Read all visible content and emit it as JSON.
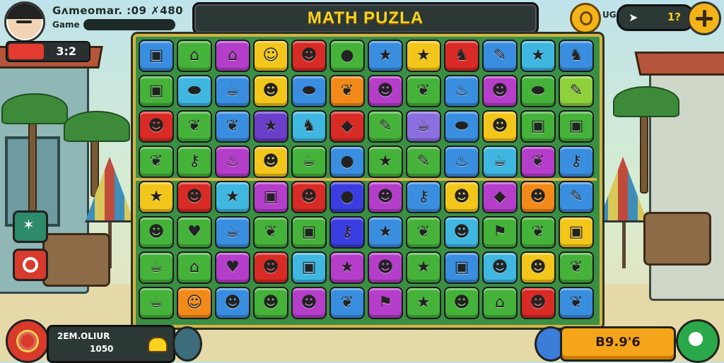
{
  "hud": {
    "player_name": "Gʌmeomar. :09  ✗480",
    "player_sub": "Game",
    "timer": "3:2",
    "timer_fraction": 0.45,
    "title": "MATH PUZLA",
    "coin_label": "UG",
    "count": "1?",
    "score_label": "2EM.OLIUR",
    "score_value": "1050",
    "points": "B9.9'6"
  },
  "colors": {
    "accent_gold": "#f7d21e",
    "board_border": "#d3b446",
    "hud_dark": "#2c3836"
  },
  "board": {
    "rows": 8,
    "cols": 12,
    "tiles": [
      [
        {
          "c": "#3a8ee0",
          "i": "cube-icon"
        },
        {
          "c": "#45b23a",
          "i": "house-icon"
        },
        {
          "c": "#b43ec9",
          "i": "house-icon"
        },
        {
          "c": "#f2c61a",
          "i": "ghost-icon"
        },
        {
          "c": "#d92b26",
          "i": "face-icon"
        },
        {
          "c": "#45b23a",
          "i": "drop-icon"
        },
        {
          "c": "#3a8ee0",
          "i": "star-icon"
        },
        {
          "c": "#f2c61a",
          "i": "star-icon"
        },
        {
          "c": "#d92b26",
          "i": "bird-icon"
        },
        {
          "c": "#3a8ee0",
          "i": "pencil-icon"
        },
        {
          "c": "#3fb7e0",
          "i": "star-icon"
        },
        {
          "c": "#3a8ee0",
          "i": "bird-icon"
        }
      ],
      [
        {
          "c": "#45b23a",
          "i": "cube-icon"
        },
        {
          "c": "#3fb7e0",
          "i": "blob-icon"
        },
        {
          "c": "#3a8ee0",
          "i": "cup-icon"
        },
        {
          "c": "#f2c61a",
          "i": "face-icon"
        },
        {
          "c": "#3a8ee0",
          "i": "blob-icon"
        },
        {
          "c": "#f28a1a",
          "i": "leaf-icon"
        },
        {
          "c": "#b43ec9",
          "i": "face-icon"
        },
        {
          "c": "#45b23a",
          "i": "leaf-icon"
        },
        {
          "c": "#3a8ee0",
          "i": "flame-icon"
        },
        {
          "c": "#b43ec9",
          "i": "face-icon"
        },
        {
          "c": "#45b23a",
          "i": "blob-icon"
        },
        {
          "c": "#8fd13a",
          "i": "pencil-icon"
        }
      ],
      [
        {
          "c": "#d92b26",
          "i": "face-icon"
        },
        {
          "c": "#45b23a",
          "i": "leaf-icon"
        },
        {
          "c": "#3a8ee0",
          "i": "leaf-icon"
        },
        {
          "c": "#6a3ec9",
          "i": "star-icon"
        },
        {
          "c": "#3fb7e0",
          "i": "bird-icon"
        },
        {
          "c": "#d92b26",
          "i": "diamond-icon"
        },
        {
          "c": "#45b23a",
          "i": "pencil-icon"
        },
        {
          "c": "#8b6ee0",
          "i": "cup-icon"
        },
        {
          "c": "#3a8ee0",
          "i": "blob-icon"
        },
        {
          "c": "#f2c61a",
          "i": "face-icon"
        },
        {
          "c": "#45b23a",
          "i": "cube-icon"
        },
        {
          "c": "#45b23a",
          "i": "cube-icon"
        }
      ],
      [
        {
          "c": "#45b23a",
          "i": "leaf-icon"
        },
        {
          "c": "#45b23a",
          "i": "key-icon"
        },
        {
          "c": "#b43ec9",
          "i": "flame-icon"
        },
        {
          "c": "#f2c61a",
          "i": "face-icon"
        },
        {
          "c": "#45b23a",
          "i": "cup-icon"
        },
        {
          "c": "#3a8ee0",
          "i": "drop-icon"
        },
        {
          "c": "#45b23a",
          "i": "star-icon"
        },
        {
          "c": "#45b23a",
          "i": "pencil-icon"
        },
        {
          "c": "#3a8ee0",
          "i": "flame-icon"
        },
        {
          "c": "#3fb7e0",
          "i": "cup-icon"
        },
        {
          "c": "#b43ec9",
          "i": "leaf-icon"
        },
        {
          "c": "#3a8ee0",
          "i": "key-icon"
        }
      ],
      [
        {
          "c": "#f2c61a",
          "i": "star-icon"
        },
        {
          "c": "#d92b26",
          "i": "face-icon"
        },
        {
          "c": "#3fb7e0",
          "i": "star-icon"
        },
        {
          "c": "#b43ec9",
          "i": "cube-icon"
        },
        {
          "c": "#d92b26",
          "i": "face-icon"
        },
        {
          "c": "#3a3ee0",
          "i": "drop-icon"
        },
        {
          "c": "#b43ec9",
          "i": "face-icon"
        },
        {
          "c": "#3a8ee0",
          "i": "key-icon"
        },
        {
          "c": "#f2c61a",
          "i": "face-icon"
        },
        {
          "c": "#b43ec9",
          "i": "diamond-icon"
        },
        {
          "c": "#f28a1a",
          "i": "face-icon"
        },
        {
          "c": "#3a8ee0",
          "i": "pencil-icon"
        }
      ],
      [
        {
          "c": "#45b23a",
          "i": "face-icon"
        },
        {
          "c": "#45b23a",
          "i": "heart-icon"
        },
        {
          "c": "#3a8ee0",
          "i": "cup-icon"
        },
        {
          "c": "#45b23a",
          "i": "leaf-icon"
        },
        {
          "c": "#45b23a",
          "i": "cube-icon"
        },
        {
          "c": "#3a3ee0",
          "i": "key-icon"
        },
        {
          "c": "#3a8ee0",
          "i": "star-icon"
        },
        {
          "c": "#45b23a",
          "i": "leaf-icon"
        },
        {
          "c": "#3fb7e0",
          "i": "face-icon"
        },
        {
          "c": "#45b23a",
          "i": "flag-icon"
        },
        {
          "c": "#45b23a",
          "i": "leaf-icon"
        },
        {
          "c": "#f2c61a",
          "i": "cube-icon"
        }
      ],
      [
        {
          "c": "#45b23a",
          "i": "cup-icon"
        },
        {
          "c": "#45b23a",
          "i": "house-icon"
        },
        {
          "c": "#b43ec9",
          "i": "heart-icon"
        },
        {
          "c": "#d92b26",
          "i": "face-icon"
        },
        {
          "c": "#3fb7e0",
          "i": "cube-icon"
        },
        {
          "c": "#b43ec9",
          "i": "star-icon"
        },
        {
          "c": "#b43ec9",
          "i": "face-icon"
        },
        {
          "c": "#45b23a",
          "i": "star-icon"
        },
        {
          "c": "#3a8ee0",
          "i": "cube-icon"
        },
        {
          "c": "#3fb7e0",
          "i": "face-icon"
        },
        {
          "c": "#f2c61a",
          "i": "face-icon"
        },
        {
          "c": "#45b23a",
          "i": "leaf-icon"
        }
      ],
      [
        {
          "c": "#45b23a",
          "i": "cup-icon"
        },
        {
          "c": "#f28a1a",
          "i": "ghost-icon"
        },
        {
          "c": "#3a8ee0",
          "i": "face-icon"
        },
        {
          "c": "#45b23a",
          "i": "face-icon"
        },
        {
          "c": "#b43ec9",
          "i": "face-icon"
        },
        {
          "c": "#3a8ee0",
          "i": "leaf-icon"
        },
        {
          "c": "#b43ec9",
          "i": "flag-icon"
        },
        {
          "c": "#45b23a",
          "i": "star-icon"
        },
        {
          "c": "#45b23a",
          "i": "face-icon"
        },
        {
          "c": "#45b23a",
          "i": "house-icon"
        },
        {
          "c": "#d92b26",
          "i": "face-icon"
        },
        {
          "c": "#3a8ee0",
          "i": "leaf-icon"
        }
      ]
    ]
  }
}
